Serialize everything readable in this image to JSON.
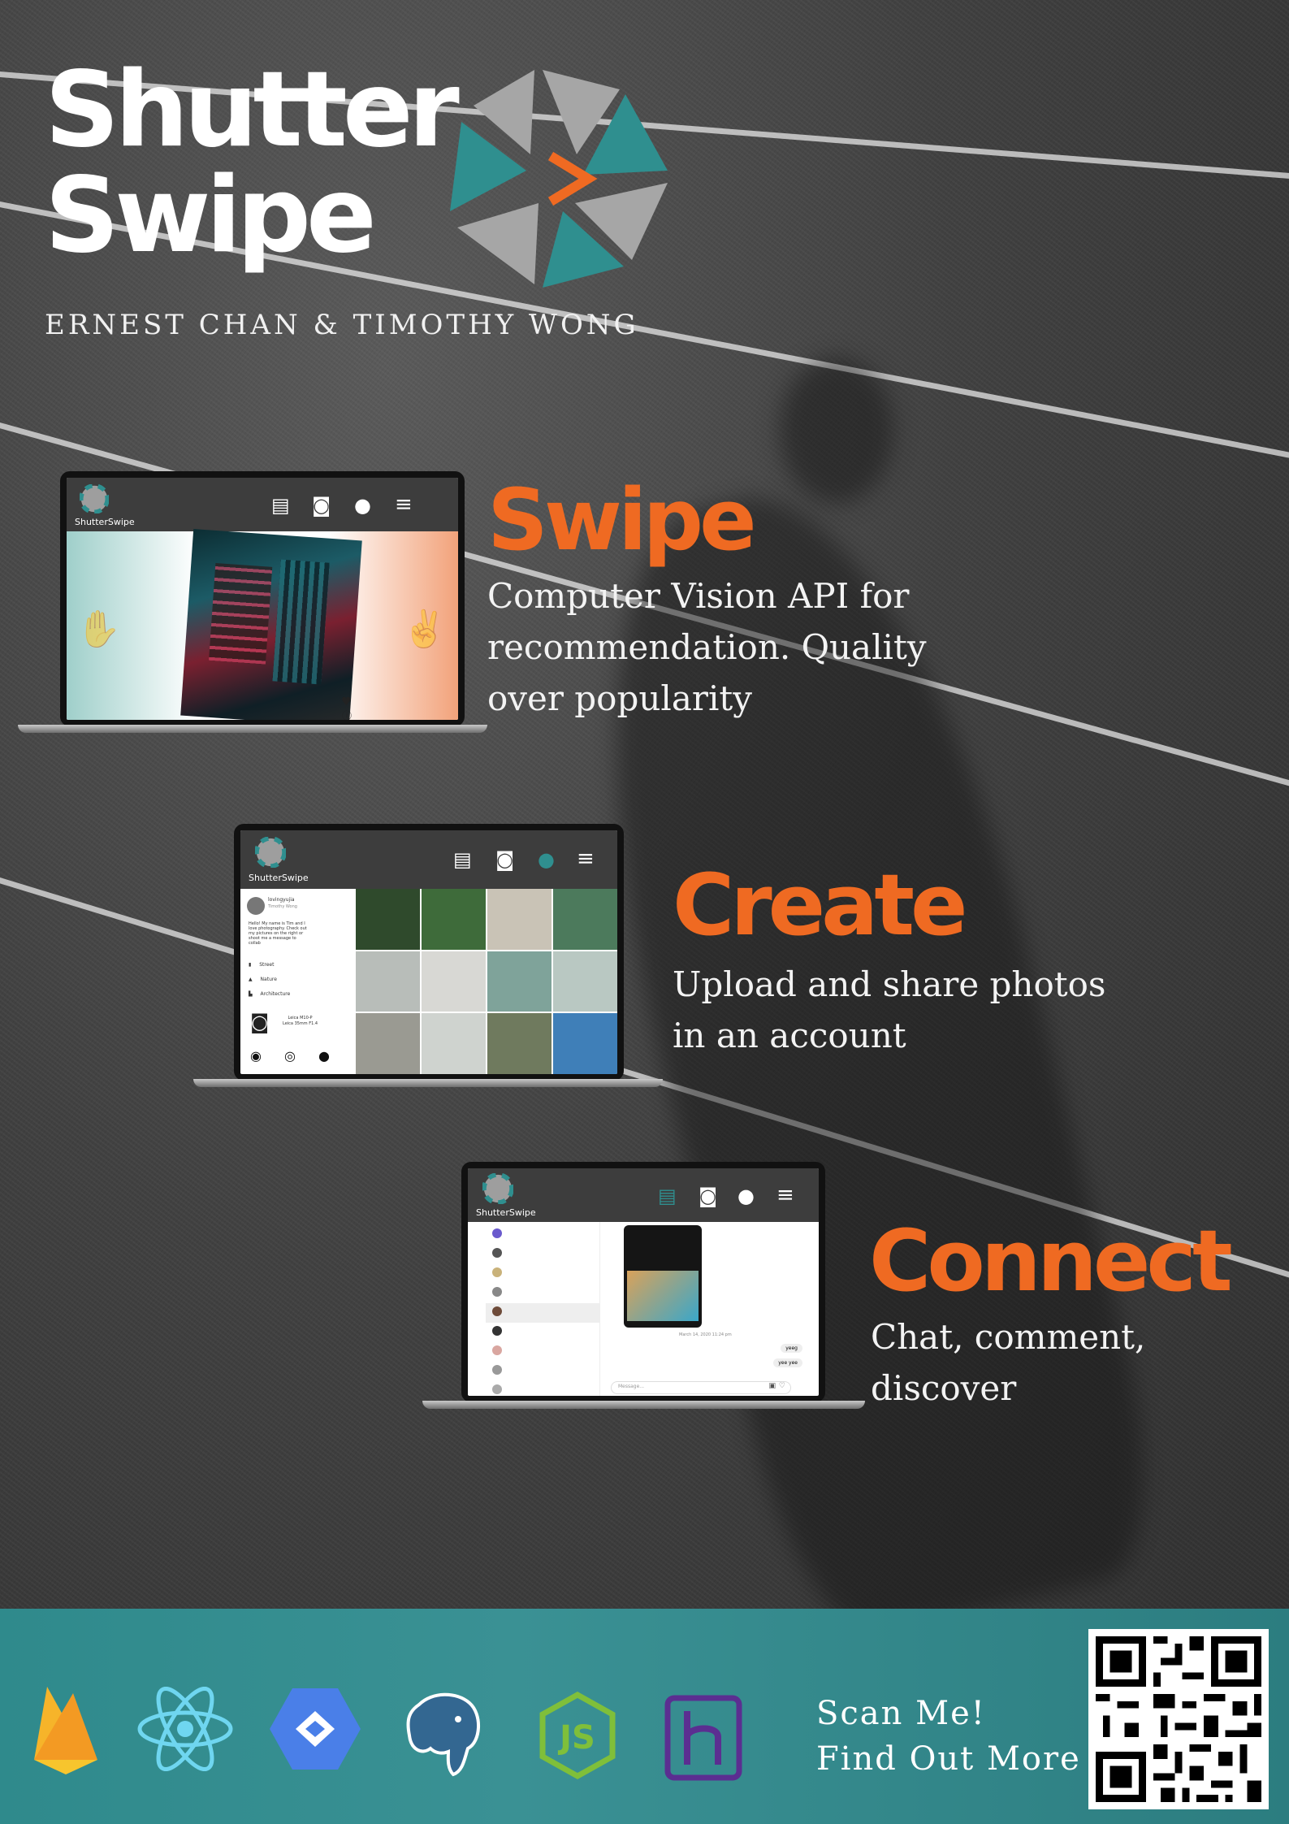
{
  "poster": {
    "title_line1": "Shutter",
    "title_line2": "Swipe",
    "authors": "ERNEST CHAN & TIMOTHY WONG"
  },
  "colors": {
    "accent_orange": "#ef6a22",
    "logo_teal": "#2f8f8f",
    "logo_gray": "#a6a6a6",
    "footer_teal": "#338c8e"
  },
  "app": {
    "brand": "ShutterSwipe",
    "nav_icons": [
      "chat-icon",
      "camera-icon",
      "account-icon",
      "menu-icon"
    ]
  },
  "features": [
    {
      "heading": "Swipe",
      "desc_lines": [
        "Computer Vision API for",
        "recommendation. Quality",
        "over popularity"
      ]
    },
    {
      "heading": "Create",
      "desc_lines": [
        "Upload and share photos",
        "in an account"
      ]
    },
    {
      "heading": "Connect",
      "desc_lines": [
        "Chat, comment, discover"
      ]
    }
  ],
  "profile_screen": {
    "username": "lovingyujia",
    "display_name": "Timothy Wong",
    "bio": "Hello! My name is Tim and I love photography. Check out my pictures on the right or shoot me a message to collab",
    "categories": [
      "Street",
      "Nature",
      "Architecture"
    ],
    "camera_lines": [
      "Leica M10-P",
      "Leica 35mm F1.4"
    ]
  },
  "chat_screen": {
    "date": "March 14, 2020 11:24 pm",
    "bubbles": [
      "yeeg",
      "yee yee"
    ],
    "message_placeholder": "Message..."
  },
  "tech_stack": [
    "firebase-logo",
    "react-logo",
    "google-cloud-vision-logo",
    "postgresql-logo",
    "nodejs-logo",
    "heroku-logo"
  ],
  "footer": {
    "scan_line1": "Scan Me!",
    "scan_line2": "Find Out More"
  }
}
